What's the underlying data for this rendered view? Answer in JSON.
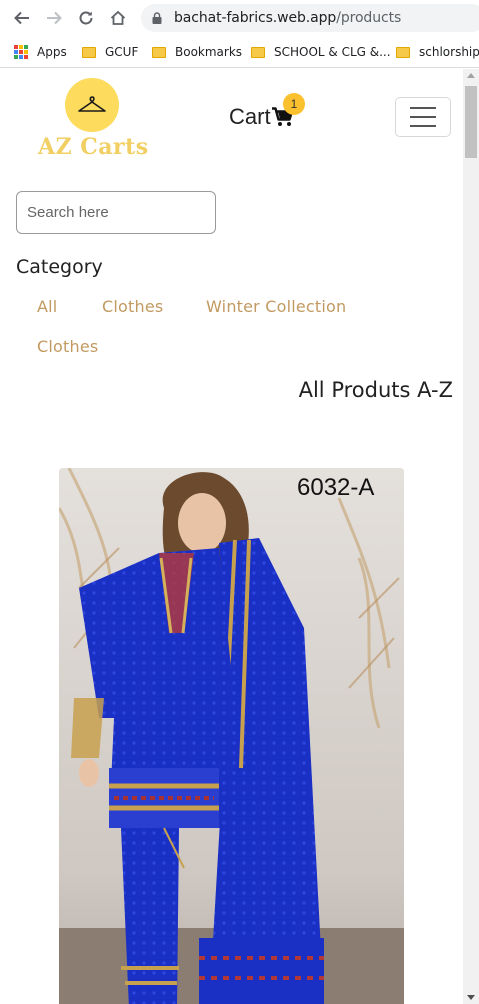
{
  "browser": {
    "url_host": "bachat-fabrics.web.app",
    "url_path": "/products",
    "bookmarks": [
      {
        "label": "Apps",
        "type": "apps"
      },
      {
        "label": "GCUF",
        "type": "folder"
      },
      {
        "label": "Bookmarks",
        "type": "folder"
      },
      {
        "label": "SCHOOL & CLG &...",
        "type": "folder"
      },
      {
        "label": "schlorships",
        "type": "folder"
      }
    ]
  },
  "header": {
    "logo_text": "AZ Carts",
    "cart_label": "Cart",
    "cart_count": "1"
  },
  "search": {
    "placeholder": "Search here"
  },
  "category": {
    "heading": "Category",
    "links": [
      "All",
      "Clothes",
      "Winter Collection",
      "Clothes"
    ]
  },
  "products": {
    "title": "All Produts A-Z",
    "items": [
      {
        "code": "6032-A"
      }
    ]
  },
  "colors": {
    "accent": "#fddb5c",
    "category_link": "#c29a61",
    "badge": "#fbc02d",
    "dress_blue": "#1a2fc4"
  }
}
